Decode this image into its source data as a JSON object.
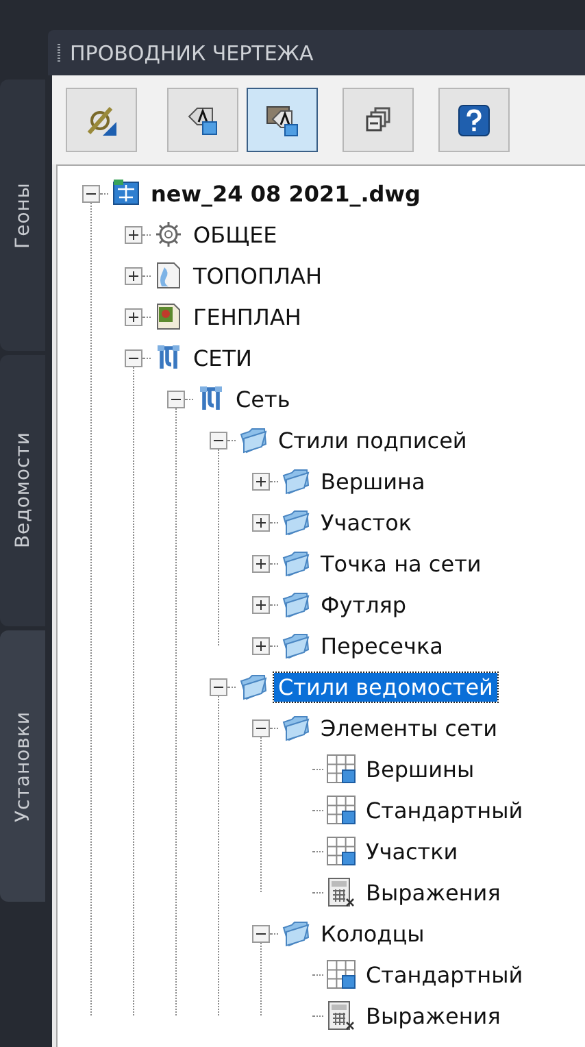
{
  "panel": {
    "title": "ПРОВОДНИК ЧЕРТЕЖА"
  },
  "side_tabs": [
    {
      "label": "Геоны",
      "selected": false
    },
    {
      "label": "Ведомости",
      "selected": false
    },
    {
      "label": "Установки",
      "selected": true
    }
  ],
  "toolbar": [
    {
      "kind": "settings",
      "pressed": false
    },
    {
      "kind": "label",
      "pressed": false
    },
    {
      "kind": "table_label",
      "pressed": true
    },
    {
      "kind": "windows",
      "pressed": false
    },
    {
      "kind": "help",
      "pressed": false
    }
  ],
  "tree": {
    "label": "new_24 08 2021_.dwg",
    "kind": "drawing",
    "expanded": true,
    "selected": false,
    "children": [
      {
        "label": "ОБЩЕЕ",
        "kind": "gear",
        "expanded": false,
        "selected": false
      },
      {
        "label": "ТОПОПЛАН",
        "kind": "topo",
        "expanded": false,
        "selected": false
      },
      {
        "label": "ГЕНПЛАН",
        "kind": "genplan",
        "expanded": false,
        "selected": false
      },
      {
        "label": "СЕТИ",
        "kind": "network",
        "expanded": true,
        "selected": false,
        "children": [
          {
            "label": "Сеть",
            "kind": "network",
            "expanded": true,
            "selected": false,
            "children": [
              {
                "label": "Стили подписей",
                "kind": "folder",
                "expanded": true,
                "selected": false,
                "children": [
                  {
                    "label": "Вершина",
                    "kind": "folder",
                    "expanded": false,
                    "selected": false
                  },
                  {
                    "label": "Участок",
                    "kind": "folder",
                    "expanded": false,
                    "selected": false
                  },
                  {
                    "label": "Точка на сети",
                    "kind": "folder",
                    "expanded": false,
                    "selected": false
                  },
                  {
                    "label": "Футляр",
                    "kind": "folder",
                    "expanded": false,
                    "selected": false
                  },
                  {
                    "label": "Пересечка",
                    "kind": "folder",
                    "expanded": false,
                    "selected": false
                  }
                ]
              },
              {
                "label": "Стили ведомостей",
                "kind": "folder",
                "expanded": true,
                "selected": true,
                "children": [
                  {
                    "label": "Элементы сети",
                    "kind": "folder",
                    "expanded": true,
                    "selected": false,
                    "children": [
                      {
                        "label": "Вершины",
                        "kind": "table",
                        "selected": false
                      },
                      {
                        "label": "Стандартный",
                        "kind": "table",
                        "selected": false
                      },
                      {
                        "label": "Участки",
                        "kind": "table",
                        "selected": false
                      },
                      {
                        "label": "Выражения",
                        "kind": "calculator",
                        "selected": false
                      }
                    ]
                  },
                  {
                    "label": "Колодцы",
                    "kind": "folder",
                    "expanded": true,
                    "selected": false,
                    "children": [
                      {
                        "label": "Стандартный",
                        "kind": "table",
                        "selected": false
                      },
                      {
                        "label": "Выражения",
                        "kind": "calculator",
                        "selected": false
                      }
                    ]
                  }
                ]
              }
            ]
          }
        ]
      }
    ]
  }
}
